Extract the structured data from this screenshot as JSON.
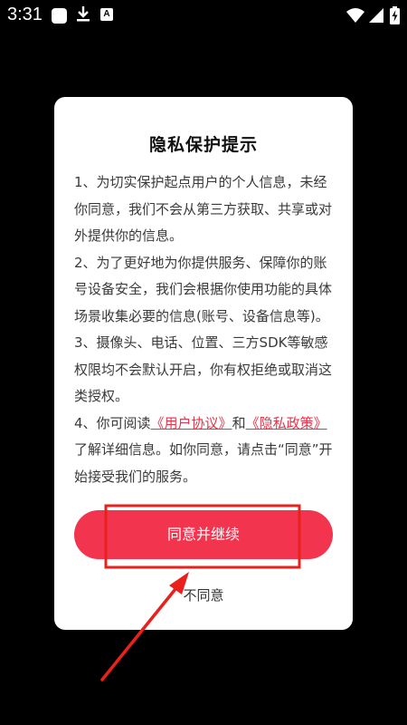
{
  "status_bar": {
    "time": "3:31",
    "notification_icons": [
      "app-notification-icon",
      "download-icon",
      "a-icon"
    ],
    "notification_a_label": "A",
    "system_icons": [
      "wifi-icon",
      "signal-icon",
      "battery-charging-icon"
    ]
  },
  "dialog": {
    "title": "隐私保护提示",
    "paragraphs": {
      "p1": "1、为切实保护起点用户的个人信息，未经你同意，我们不会从第三方获取、共享或对外提供你的信息。",
      "p2": "2、为了更好地为你提供服务、保障你的账号设备安全，我们会根据你使用功能的具体场景收集必要的信息(账号、设备信息等)。",
      "p3": "3、摄像头、电话、位置、三方SDK等敏感权限均不会默认开启，你有权拒绝或取消这类授权。",
      "p4": {
        "prefix": "4、你可阅读",
        "link_user_agreement": "《用户协议》",
        "and": "和",
        "link_privacy_policy": "《隐私政策》",
        "suffix": "了解详细信息。如你同意，请点击“同意”开始接受我们的服务。"
      }
    },
    "agree_button": "同意并继续",
    "disagree_link": "不同意"
  },
  "annotation": {
    "highlight_color": "#e8211d",
    "arrow_color": "#e8211d"
  },
  "colors": {
    "accent": "#f3344e",
    "link": "#e8324a",
    "background": "#000000",
    "dialog": "#ffffff"
  }
}
